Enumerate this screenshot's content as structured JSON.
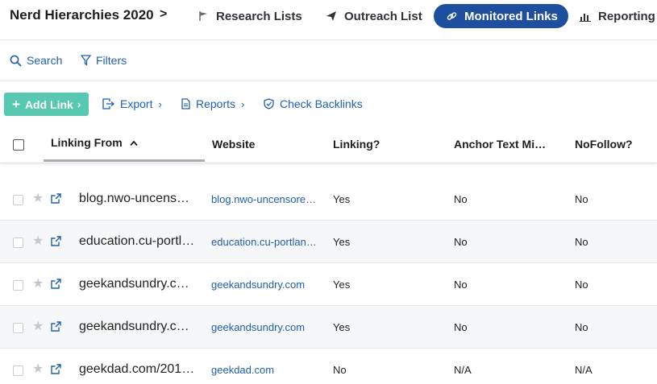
{
  "header": {
    "project_title": "Nerd Hierarchies 2020",
    "project_chevron": ">",
    "nav": {
      "research_lists": "Research Lists",
      "outreach_list": "Outreach List",
      "monitored_links": "Monitored Links",
      "reporting": "Reporting"
    },
    "active_tab_color": "#1e4e9e"
  },
  "searchbar": {
    "search_label": "Search",
    "filters_label": "Filters"
  },
  "toolbar": {
    "add_link_label": "Add Link",
    "export_label": "Export",
    "reports_label": "Reports",
    "check_backlinks_label": "Check Backlinks",
    "add_button_color": "#58c8b0"
  },
  "table": {
    "columns": {
      "linking_from": "Linking From",
      "website": "Website",
      "linking": "Linking?",
      "anchor_text": "Anchor Text Mis…",
      "nofollow": "NoFollow?"
    },
    "sort": {
      "column": "Linking From",
      "direction": "ascending"
    },
    "rows": [
      {
        "linking_from": "blog.nwo-uncens…",
        "website": "blog.nwo-uncensore…",
        "linking": "Yes",
        "anchor_text": "No",
        "nofollow": "No"
      },
      {
        "linking_from": "education.cu-portl…",
        "website": "education.cu-portlan…",
        "linking": "Yes",
        "anchor_text": "No",
        "nofollow": "No"
      },
      {
        "linking_from": "geekandsundry.c…",
        "website": "geekandsundry.com",
        "linking": "Yes",
        "anchor_text": "No",
        "nofollow": "No"
      },
      {
        "linking_from": "geekandsundry.c…",
        "website": "geekandsundry.com",
        "linking": "Yes",
        "anchor_text": "No",
        "nofollow": "No"
      },
      {
        "linking_from": "geekdad.com/201…",
        "website": "geekdad.com",
        "linking": "No",
        "anchor_text": "N/A",
        "nofollow": "N/A"
      }
    ]
  },
  "icons": {
    "research_lists": "flag-icon",
    "outreach_list": "paper-plane-icon",
    "monitored_links": "link-icon",
    "reporting": "bar-chart-icon",
    "search": "search-icon",
    "filters": "filter-icon",
    "export": "export-icon",
    "reports": "document-icon",
    "check_backlinks": "shield-check-icon",
    "row_star": "star-icon",
    "row_open": "external-link-icon"
  }
}
